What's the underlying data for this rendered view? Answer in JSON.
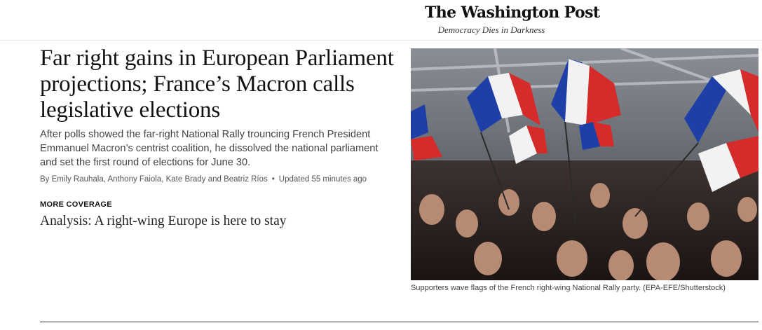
{
  "masthead": {
    "logo": "The Washington Post",
    "tagline": "Democracy Dies in Darkness"
  },
  "story": {
    "headline": "Far right gains in European Parliament projections; France’s Macron calls legislative elections",
    "dek": "After polls showed the far-right National Rally trouncing French President Emmanuel Macron’s centrist coalition, he dissolved the national parliament and set the first round of elections for June 30.",
    "byline": "By Emily Rauhala, Anthony Faiola, Kate Brady and Beatriz Ríos",
    "separator": "•",
    "updated": "Updated 55 minutes ago"
  },
  "more_coverage": {
    "label": "MORE COVERAGE",
    "link": "Analysis: A right-wing Europe is here to stay"
  },
  "photo": {
    "caption": "Supporters wave flags of the French right-wing National Rally party. (EPA-EFE/Shutterstock)",
    "colors": {
      "blue": "#1f3fa8",
      "white": "#f2f2f2",
      "red": "#d62b2b"
    }
  }
}
